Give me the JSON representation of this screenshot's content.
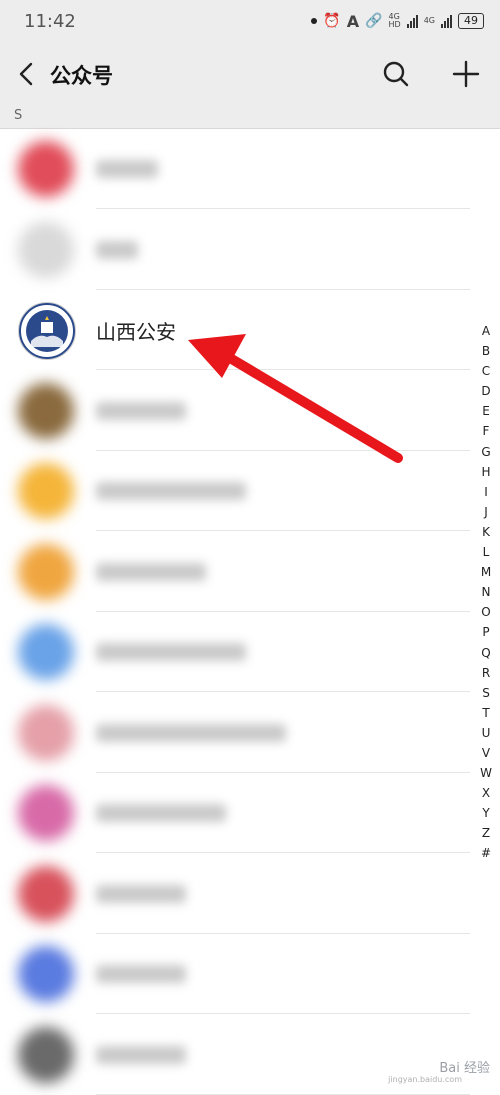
{
  "status_bar": {
    "time": "11:42",
    "hd1": "HD",
    "net1": "4G",
    "net2": "4G",
    "battery": "49"
  },
  "header": {
    "back_icon": "chevron-left-icon",
    "title": "公众号",
    "search_icon": "search-icon",
    "add_icon": "plus-icon"
  },
  "section": {
    "letter": "S"
  },
  "accounts": [
    {
      "name": "",
      "blurred": true,
      "avatar_color": "#e14d5a"
    },
    {
      "name": "",
      "blurred": true,
      "avatar_color": "#d9d9d9"
    },
    {
      "name": "山西公安",
      "blurred": false,
      "avatar_color": "#2b4a8c"
    },
    {
      "name": "",
      "blurred": true,
      "avatar_color": "#8a6a3e"
    },
    {
      "name": "",
      "blurred": true,
      "avatar_color": "#f5b53a"
    },
    {
      "name": "",
      "blurred": true,
      "avatar_color": "#f0a640"
    },
    {
      "name": "",
      "blurred": true,
      "avatar_color": "#6aa3e8"
    },
    {
      "name": "",
      "blurred": true,
      "avatar_color": "#e5a0a8"
    },
    {
      "name": "",
      "blurred": true,
      "avatar_color": "#d86aa8"
    },
    {
      "name": "",
      "blurred": true,
      "avatar_color": "#d8525c"
    },
    {
      "name": "",
      "blurred": true,
      "avatar_color": "#5a7be0"
    },
    {
      "name": "",
      "blurred": true,
      "avatar_color": "#6a6a6a"
    }
  ],
  "index_letters": [
    "A",
    "B",
    "C",
    "D",
    "E",
    "F",
    "G",
    "H",
    "I",
    "J",
    "K",
    "L",
    "M",
    "N",
    "O",
    "P",
    "Q",
    "R",
    "S",
    "T",
    "U",
    "V",
    "W",
    "X",
    "Y",
    "Z",
    "#"
  ],
  "annotation": {
    "arrow_color": "#e8171c"
  },
  "watermark": {
    "text": "Bai 经验",
    "sub": "jingyan.baidu.com"
  }
}
